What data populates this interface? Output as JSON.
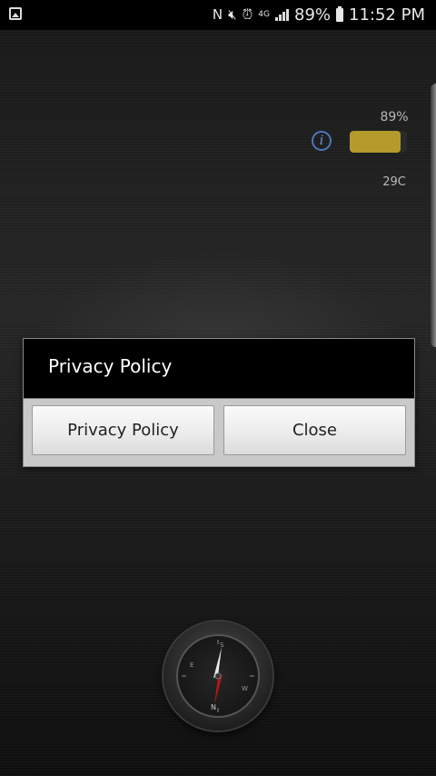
{
  "status_bar": {
    "battery_percent": "89%",
    "time": "11:52 PM",
    "icons": [
      "gallery-icon",
      "nfc-icon",
      "mute-icon",
      "alarm-icon",
      "data-icon",
      "signal-icon",
      "battery-icon"
    ]
  },
  "widget": {
    "battery_text": "89%",
    "battery_level": 0.89,
    "battery_color": "#b59a2c",
    "temperature": "29C",
    "info_icon": "i"
  },
  "dialog": {
    "title": "Privacy Policy",
    "buttons": {
      "privacy_label": "Privacy Policy",
      "close_label": "Close"
    }
  },
  "compass": {
    "directions": [
      "N",
      "E",
      "S",
      "W"
    ]
  }
}
